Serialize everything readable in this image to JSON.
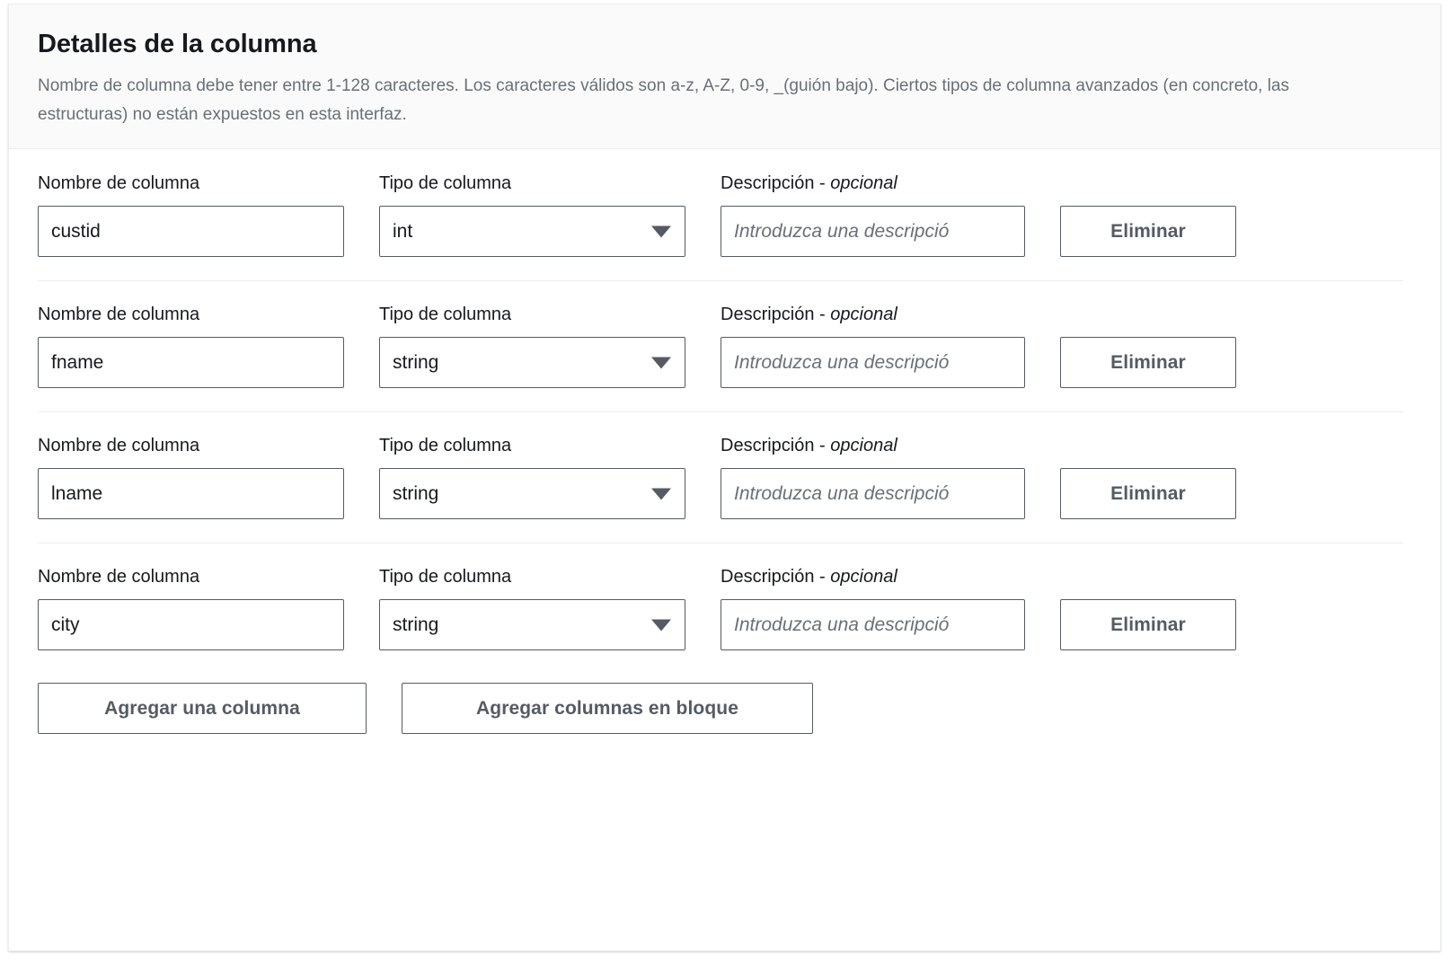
{
  "panel": {
    "title": "Detalles de la columna",
    "description": "Nombre de columna debe tener entre 1-128 caracteres. Los caracteres válidos son a-z, A-Z, 0-9, _(guión bajo). Ciertos tipos de columna avanzados (en concreto, las estructuras) no están expuestos en esta interfaz."
  },
  "labels": {
    "column_name": "Nombre de columna",
    "column_type": "Tipo de columna",
    "description_main": "Descripción - ",
    "description_optional": "opcional"
  },
  "placeholders": {
    "description": "Introduzca una descripció"
  },
  "buttons": {
    "delete": "Eliminar",
    "add_column": "Agregar una columna",
    "add_bulk": "Agregar columnas en bloque"
  },
  "icons": {
    "dropdown": "chevron-down-icon"
  },
  "colors": {
    "border": "#545b64",
    "text": "#16191f",
    "muted_text": "#687078",
    "header_bg": "#fafafa",
    "divider": "#eaeded"
  },
  "rows": [
    {
      "name": "custid",
      "type": "int",
      "description": ""
    },
    {
      "name": "fname",
      "type": "string",
      "description": ""
    },
    {
      "name": "lname",
      "type": "string",
      "description": ""
    },
    {
      "name": "city",
      "type": "string",
      "description": ""
    }
  ]
}
